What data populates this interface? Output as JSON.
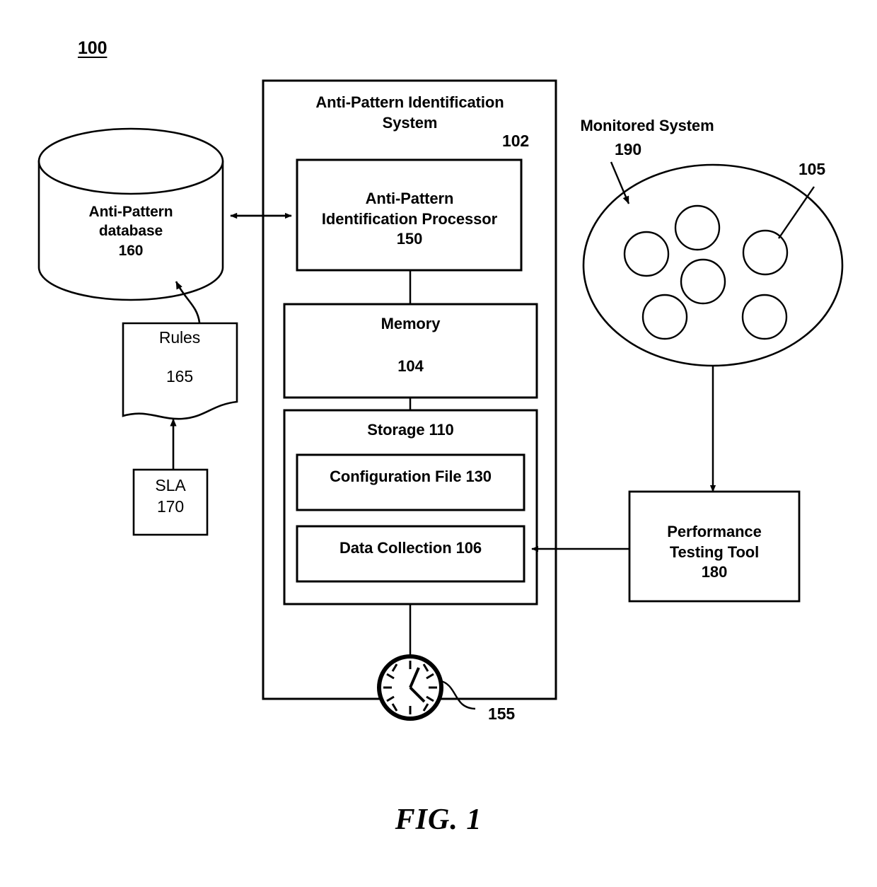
{
  "figure": {
    "number": "100",
    "caption": "FIG. 1"
  },
  "system_box": {
    "title": "Anti-Pattern Identification\nSystem",
    "ref": "102"
  },
  "processor_box": {
    "title": "Anti-Pattern\nIdentification Processor\n150"
  },
  "memory_box": {
    "title": "Memory",
    "ref": "104"
  },
  "storage_box": {
    "title": "Storage 110",
    "children": [
      {
        "label": "Configuration File 130",
        "name": "configuration-file-box"
      },
      {
        "label": "Data Collection 106",
        "name": "data-collection-box"
      }
    ]
  },
  "database": {
    "label": "Anti-Pattern\ndatabase\n160"
  },
  "rules_doc": {
    "title": "Rules",
    "ref": "165"
  },
  "sla_box": {
    "title": "SLA",
    "ref": "170"
  },
  "monitored_system": {
    "title": "Monitored System",
    "ref": "190",
    "node_ref": "105",
    "node_count": 6
  },
  "performance_tool": {
    "title": "Performance\nTesting Tool\n180"
  },
  "clock": {
    "ref": "155",
    "icon": "clock-icon"
  },
  "style": {
    "stroke": "#000000",
    "fill": "#ffffff",
    "background": "#ffffff"
  }
}
